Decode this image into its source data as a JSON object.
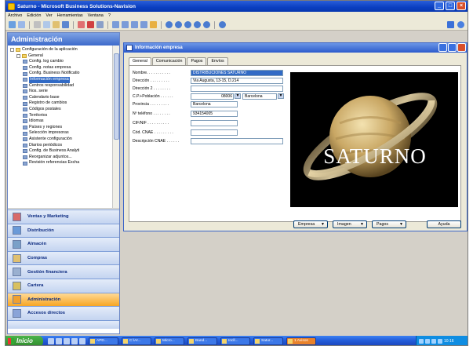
{
  "app": {
    "title": "Saturno - Microsoft Business Solutions-Navision"
  },
  "menu": [
    "Archivo",
    "Edición",
    "Ver",
    "Herramientas",
    "Ventana",
    "?"
  ],
  "left_panel": {
    "title": "Administración",
    "tree": [
      {
        "label": "Configuración de la aplicación",
        "level": 0,
        "icon": "folder",
        "expander": true
      },
      {
        "label": "General",
        "level": 1,
        "icon": "folder",
        "expander": true
      },
      {
        "label": "Config. log cambio",
        "level": 2,
        "icon": "form"
      },
      {
        "label": "Config. notas empresa",
        "level": 2,
        "icon": "form"
      },
      {
        "label": "Config. Business Notificatio",
        "level": 2,
        "icon": "form"
      },
      {
        "label": "Información empresa",
        "level": 2,
        "icon": "form",
        "selected": true
      },
      {
        "label": "Centros responsabilidad",
        "level": 2,
        "icon": "form"
      },
      {
        "label": "Nos. serie",
        "level": 2,
        "icon": "form"
      },
      {
        "label": "Calendario base",
        "level": 2,
        "icon": "form"
      },
      {
        "label": "Registro de cambios",
        "level": 2,
        "icon": "form"
      },
      {
        "label": "Códigos postales",
        "level": 2,
        "icon": "form"
      },
      {
        "label": "Territorios",
        "level": 2,
        "icon": "form"
      },
      {
        "label": "Idiomas",
        "level": 2,
        "icon": "form"
      },
      {
        "label": "Países y regiones",
        "level": 2,
        "icon": "form"
      },
      {
        "label": "Selección impresoras",
        "level": 2,
        "icon": "form"
      },
      {
        "label": "Asistente configuración",
        "level": 2,
        "icon": "form"
      },
      {
        "label": "Diarios periódicos",
        "level": 2,
        "icon": "form"
      },
      {
        "label": "Config. de Business Analyti",
        "level": 2,
        "icon": "form"
      },
      {
        "label": "Reorganizar adjuntos...",
        "level": 2,
        "icon": "form"
      },
      {
        "label": "Revisión referencias Excha",
        "level": 2,
        "icon": "form"
      }
    ],
    "sections": [
      {
        "label": "Ventas y Marketing",
        "active": false
      },
      {
        "label": "Distribución",
        "active": false
      },
      {
        "label": "Almacén",
        "active": false
      },
      {
        "label": "Compras",
        "active": false
      },
      {
        "label": "Gestión financiera",
        "active": false
      },
      {
        "label": "Cartera",
        "active": false
      },
      {
        "label": "Administración",
        "active": true
      },
      {
        "label": "Accesos directos",
        "active": false
      }
    ]
  },
  "form": {
    "title": "Información empresa",
    "tabs": [
      "General",
      "Comunicación",
      "Pagos",
      "Envíos"
    ],
    "active_tab": "General",
    "fields": {
      "nombre": {
        "label": "Nombre. . . . . . . . . . .",
        "value": "DISTRIBUCIONES SATURNO"
      },
      "direccion": {
        "label": "Dirección . . . . . . . . .",
        "value": "Via Augusta, 13-15, D.214"
      },
      "direccion2": {
        "label": "Dirección 2 . . . . . . . .",
        "value": ""
      },
      "cp": {
        "label": "C.P.+Población . . . . . .",
        "value": "08006",
        "poblacion": "Barcelona"
      },
      "provincia": {
        "label": "Provincia . . . . . . . . .",
        "value": "Barcelona"
      },
      "telefono": {
        "label": "Nº teléfono . . . . . . . .",
        "value": "934154005"
      },
      "cif": {
        "label": "CIF/NIF . . . . . . . . . .",
        "value": ""
      },
      "cnae": {
        "label": "Cód. CNAE . . . . . . . . .",
        "value": ""
      },
      "desc_cnae": {
        "label": "Descripción CNAE . . . . . .",
        "value": ""
      }
    },
    "image_caption": "SATURNO",
    "buttons": {
      "empresa": "Empresa",
      "imagen": "Imagen",
      "pagos": "Pagos",
      "ayuda": "Ayuda"
    }
  },
  "taskbar": {
    "start": "Inicio",
    "tasks": [
      {
        "label": "APD...",
        "active": false
      },
      {
        "label": "C:\\Ar...",
        "active": false
      },
      {
        "label": "Micro...",
        "active": false
      },
      {
        "label": "Band...",
        "active": false
      },
      {
        "label": "Incll...",
        "active": false
      },
      {
        "label": "Satur...",
        "active": false
      },
      {
        "label": "1 Avisos",
        "active": true
      }
    ],
    "clock": "10:16"
  },
  "colors": {
    "title_blue": "#0a3ec0",
    "active_section": "#f7a623",
    "selection": "#316ac5",
    "saturn_bg": "#000000",
    "saturn_text": "#ffffff"
  }
}
